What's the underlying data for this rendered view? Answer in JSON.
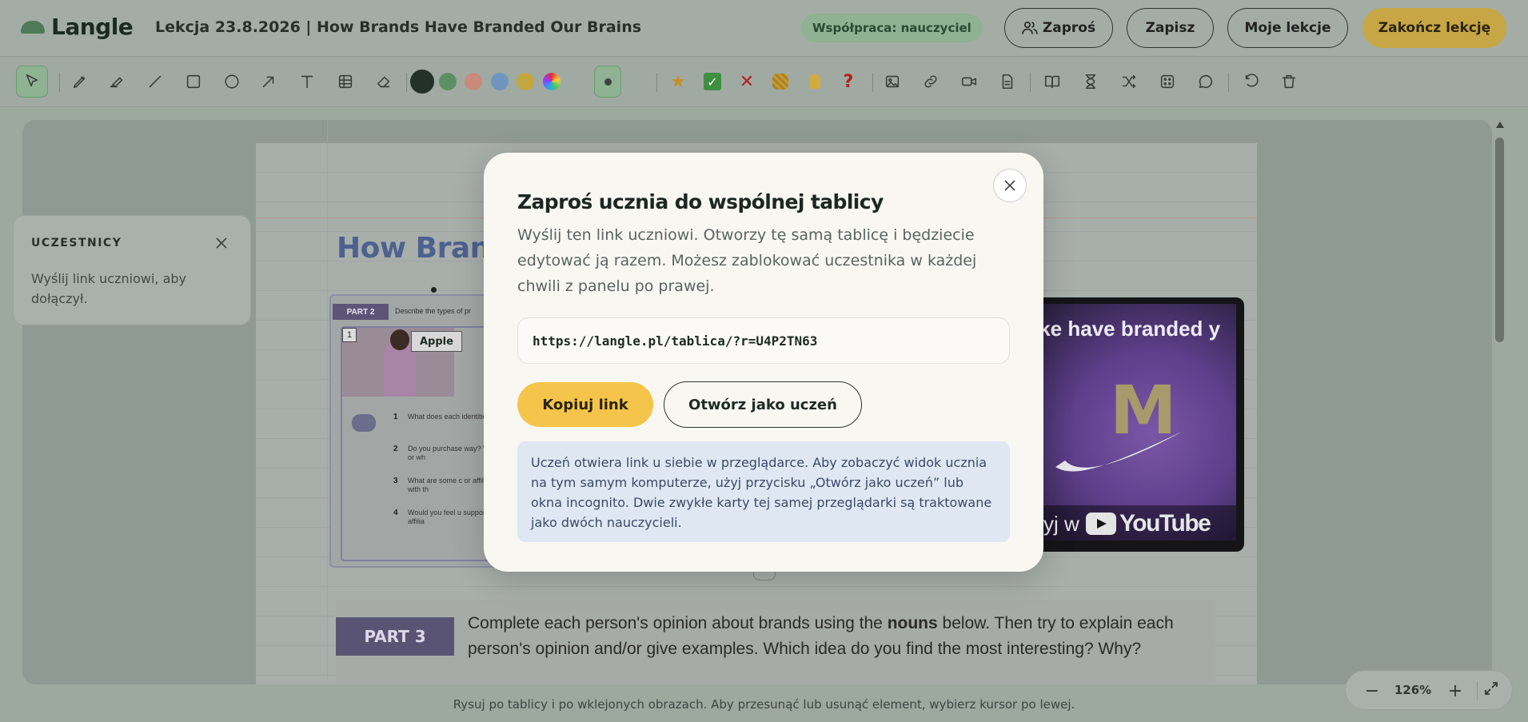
{
  "app": {
    "name": "Langle"
  },
  "header": {
    "lesson_title": "Lekcja 23.8.2026 | How Brands Have Branded Our Brains",
    "collab_badge": "Współpraca: nauczyciel",
    "invite_label": "Zaproś",
    "save_label": "Zapisz",
    "my_lessons_label": "Moje lekcje",
    "end_lesson_label": "Zakończ lekcję"
  },
  "toolbar": {
    "tools": [
      "cursor-icon",
      "pencil-icon",
      "highlighter-icon",
      "line-icon",
      "rectangle-icon",
      "circle-icon",
      "arrow-icon",
      "text-icon",
      "table-icon",
      "eraser-icon"
    ],
    "colors": [
      "#233129",
      "#5d8f66",
      "#c98a7c",
      "#6f95bf",
      "#c6a63f"
    ],
    "selected_color": "#233129",
    "stamps": [
      "star-icon",
      "checkmark-icon",
      "cross-icon",
      "clap-icon",
      "lightbulb-icon",
      "question-icon"
    ],
    "stamp_question": "?",
    "inserts": [
      "image-icon",
      "link-icon",
      "video-icon",
      "document-icon",
      "book-icon",
      "timer-icon",
      "shuffle-icon",
      "dice-icon",
      "comment-icon",
      "undo-icon",
      "trash-icon"
    ]
  },
  "board": {
    "heading": "How Brand",
    "worksheet": {
      "tag": "PART 2",
      "desc": "Describe the types of pr",
      "card_number": "1",
      "card_brand": "Apple",
      "questions": [
        {
          "n": "1",
          "text": "What does each identities?"
        },
        {
          "n": "2",
          "text": "Do you purchase way? Why or wh"
        },
        {
          "n": "3",
          "text": "What are some c or affiliate with th"
        },
        {
          "n": "4",
          "text": "Would you feel u support, or affilia"
        }
      ]
    },
    "video": {
      "title": "ike have branded y",
      "watch_label": "zyj w",
      "platform": "YouTube"
    },
    "part3": {
      "tag": "PART 3",
      "text_before": "Complete each person's opinion about brands using the ",
      "text_bold": "nouns",
      "text_after": " below. Then try to explain each person's opinion and/or give examples. Which idea do you find the most interesting? Why?"
    }
  },
  "participants": {
    "title": "UCZESTNICY",
    "text": "Wyślij link uczniowi, aby dołączył."
  },
  "zoom": {
    "value": "126%",
    "minus": "−",
    "plus": "+"
  },
  "hint": "Rysuj po tablicy i po wklejonych obrazach. Aby przesunąć lub usunąć element, wybierz kursor po lewej.",
  "modal": {
    "title": "Zaproś ucznia do wspólnej tablicy",
    "description": "Wyślij ten link uczniowi. Otworzy tę samą tablicę i będziecie edytować ją razem. Możesz zablokować uczestnika w każdej chwili z panelu po prawej.",
    "link": "https://langle.pl/tablica/?r=U4P2TN63",
    "copy_label": "Kopiuj link",
    "open_student_label": "Otwórz jako uczeń",
    "info": "Uczeń otwiera link u siebie w przeglądarce. Aby zobaczyć widok ucznia na tym samym komputerze, użyj przycisku „Otwórz jako uczeń” lub okna incognito. Dwie zwykłe karty tej samej przeglądarki są traktowane jako dwóch nauczycieli."
  }
}
